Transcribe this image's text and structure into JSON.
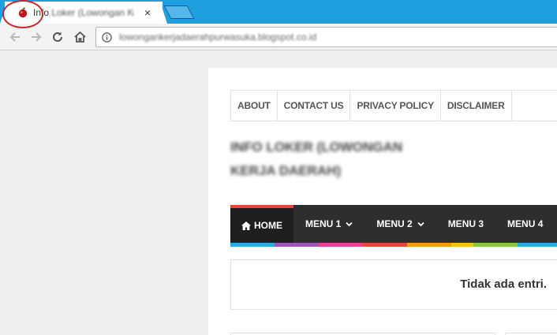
{
  "browser": {
    "tab": {
      "title_visible": "Info",
      "title_blurred": "Loker (Lowongan Ke",
      "close_label": "×"
    },
    "address": {
      "url": "lowongankerjadaerahpurwasuka.blogspot.co.id"
    },
    "colors": {
      "tabstrip": "#1e9fe0",
      "annotation_circle": "#d6202a"
    }
  },
  "page": {
    "top_nav": [
      "ABOUT",
      "CONTACT US",
      "PRIVACY POLICY",
      "DISCLAIMER"
    ],
    "site_title_line1": "Info Loker (Lowongan",
    "site_title_line2": "Kerja Daerah)",
    "main_nav": {
      "home": "HOME",
      "items": [
        "MENU 1",
        "MENU 2",
        "MENU 3",
        "MENU 4"
      ]
    },
    "stripe_colors": [
      "#29abe2",
      "#29abe2",
      "#9b59b6",
      "#9b59b6",
      "#e84393",
      "#e84393",
      "#e8453c",
      "#e8453c",
      "#f39c12",
      "#f39c12",
      "#f1c40f",
      "#8cc63f",
      "#8cc63f",
      "#29abe2",
      "#29abe2"
    ],
    "empty_message": "Tidak ada entri."
  }
}
